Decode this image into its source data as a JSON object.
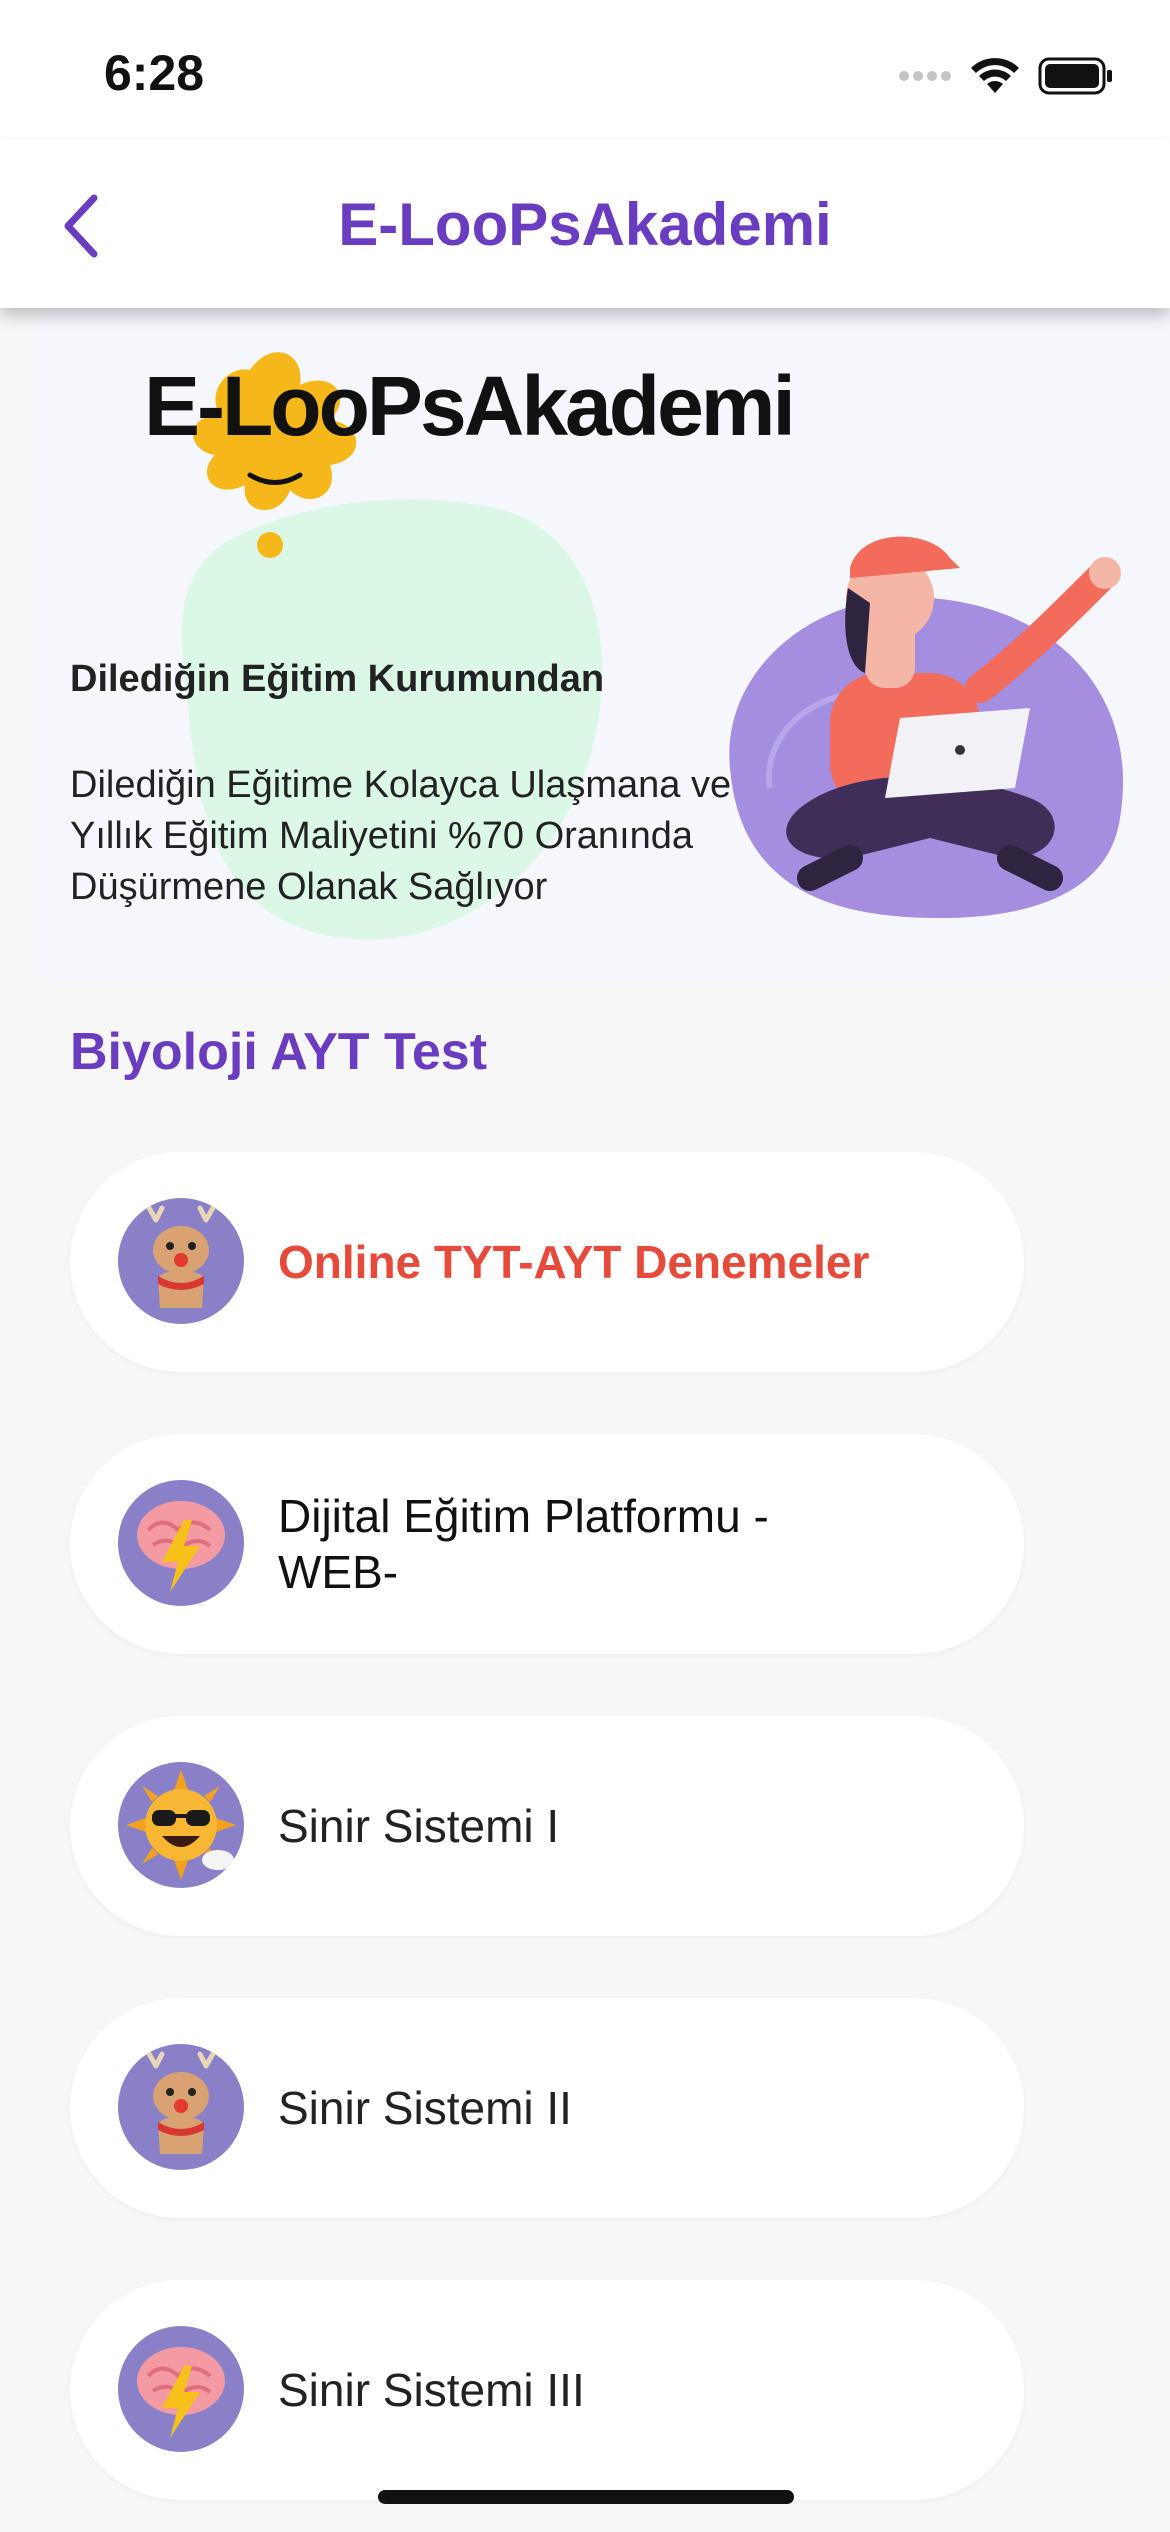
{
  "status_bar": {
    "time": "6:28"
  },
  "app_bar": {
    "title": "E-LooPsAkademi",
    "back_icon": "chevron-left-icon"
  },
  "hero": {
    "logo_text": "E-LooPsAkademi",
    "title": "Dilediğin Eğitim Kurumundan",
    "body": "Dilediğin Eğitime Kolayca Ulaşmana ve Yıllık Eğitim Maliyetini %70 Oranında Düşürmene Olanak Sağlıyor"
  },
  "section": {
    "title": "Biyoloji AYT Test"
  },
  "items": [
    {
      "label": "Online TYT-AYT Denemeler",
      "icon": "reindeer-icon"
    },
    {
      "label": "Dijital Eğitim Platformu -WEB-",
      "icon": "brain-lightning-icon"
    },
    {
      "label": "Sinir Sistemi I",
      "icon": "sun-sunglasses-icon"
    },
    {
      "label": "Sinir Sistemi II",
      "icon": "reindeer-icon"
    },
    {
      "label": "Sinir Sistemi III",
      "icon": "brain-lightning-icon"
    }
  ],
  "colors": {
    "accent": "#6a3cc0",
    "highlight": "#e64a3a",
    "avatar_bg": "#8a80c8"
  }
}
